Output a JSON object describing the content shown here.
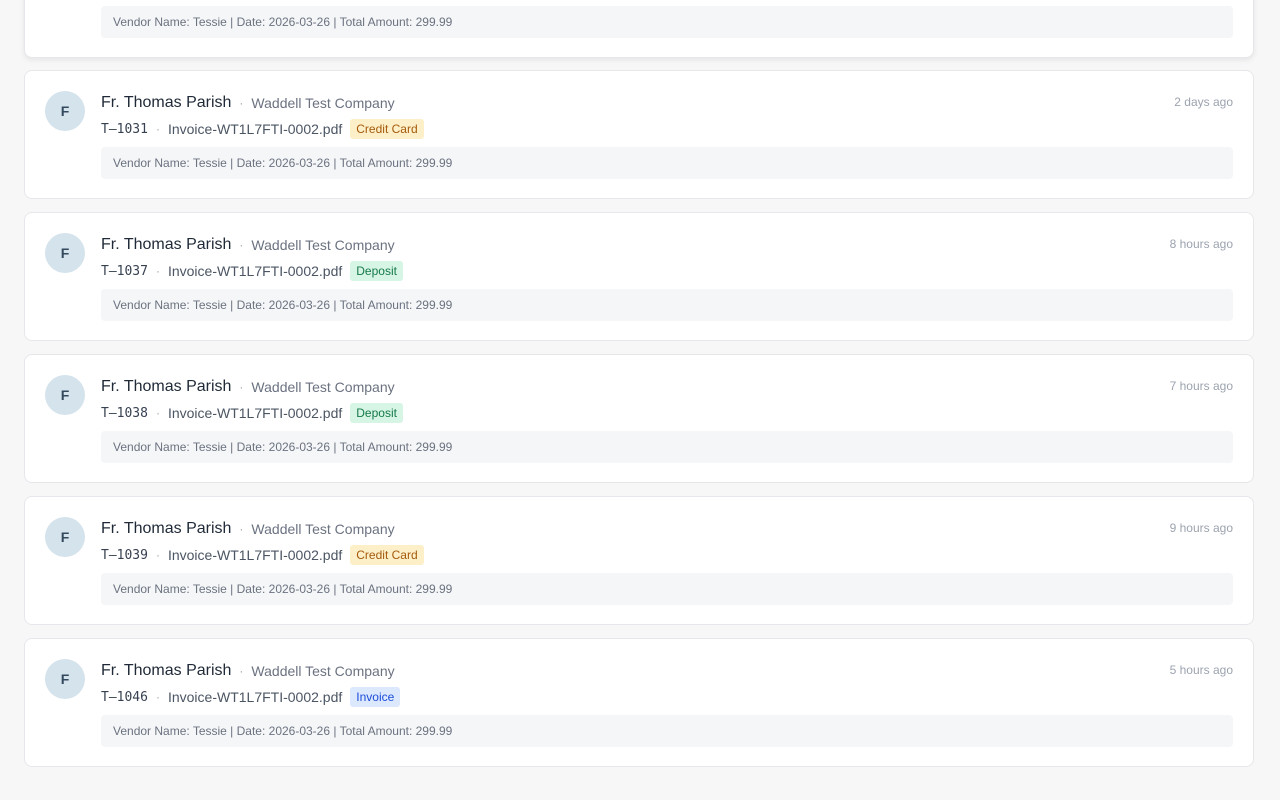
{
  "partial_card": {
    "details": "Vendor Name: Tessie | Date: 2026-03-26 | Total Amount: 299.99"
  },
  "cards": [
    {
      "avatar_letter": "F",
      "name": "Fr. Thomas Parish",
      "separator": "·",
      "company": "Waddell Test Company",
      "time": "2 days ago",
      "transaction_id": "T–1031",
      "file": "Invoice-WT1L7FTI-0002.pdf",
      "badge": "Credit Card",
      "badge_bg": "#fdf0c8",
      "badge_fg": "#a55a0c",
      "details": "Vendor Name: Tessie | Date: 2026-03-26 | Total Amount: 299.99"
    },
    {
      "avatar_letter": "F",
      "name": "Fr. Thomas Parish",
      "separator": "·",
      "company": "Waddell Test Company",
      "time": "8 hours ago",
      "transaction_id": "T–1037",
      "file": "Invoice-WT1L7FTI-0002.pdf",
      "badge": "Deposit",
      "badge_bg": "#d6f5e4",
      "badge_fg": "#16794a",
      "details": "Vendor Name: Tessie | Date: 2026-03-26 | Total Amount: 299.99"
    },
    {
      "avatar_letter": "F",
      "name": "Fr. Thomas Parish",
      "separator": "·",
      "company": "Waddell Test Company",
      "time": "7 hours ago",
      "transaction_id": "T–1038",
      "file": "Invoice-WT1L7FTI-0002.pdf",
      "badge": "Deposit",
      "badge_bg": "#d6f5e4",
      "badge_fg": "#16794a",
      "details": "Vendor Name: Tessie | Date: 2026-03-26 | Total Amount: 299.99"
    },
    {
      "avatar_letter": "F",
      "name": "Fr. Thomas Parish",
      "separator": "·",
      "company": "Waddell Test Company",
      "time": "9 hours ago",
      "transaction_id": "T–1039",
      "file": "Invoice-WT1L7FTI-0002.pdf",
      "badge": "Credit Card",
      "badge_bg": "#fdf0c8",
      "badge_fg": "#a55a0c",
      "details": "Vendor Name: Tessie | Date: 2026-03-26 | Total Amount: 299.99"
    },
    {
      "avatar_letter": "F",
      "name": "Fr. Thomas Parish",
      "separator": "·",
      "company": "Waddell Test Company",
      "time": "5 hours ago",
      "transaction_id": "T–1046",
      "file": "Invoice-WT1L7FTI-0002.pdf",
      "badge": "Invoice",
      "badge_bg": "#dbe8fd",
      "badge_fg": "#1d4ed8",
      "details": "Vendor Name: Tessie | Date: 2026-03-26 | Total Amount: 299.99"
    }
  ]
}
